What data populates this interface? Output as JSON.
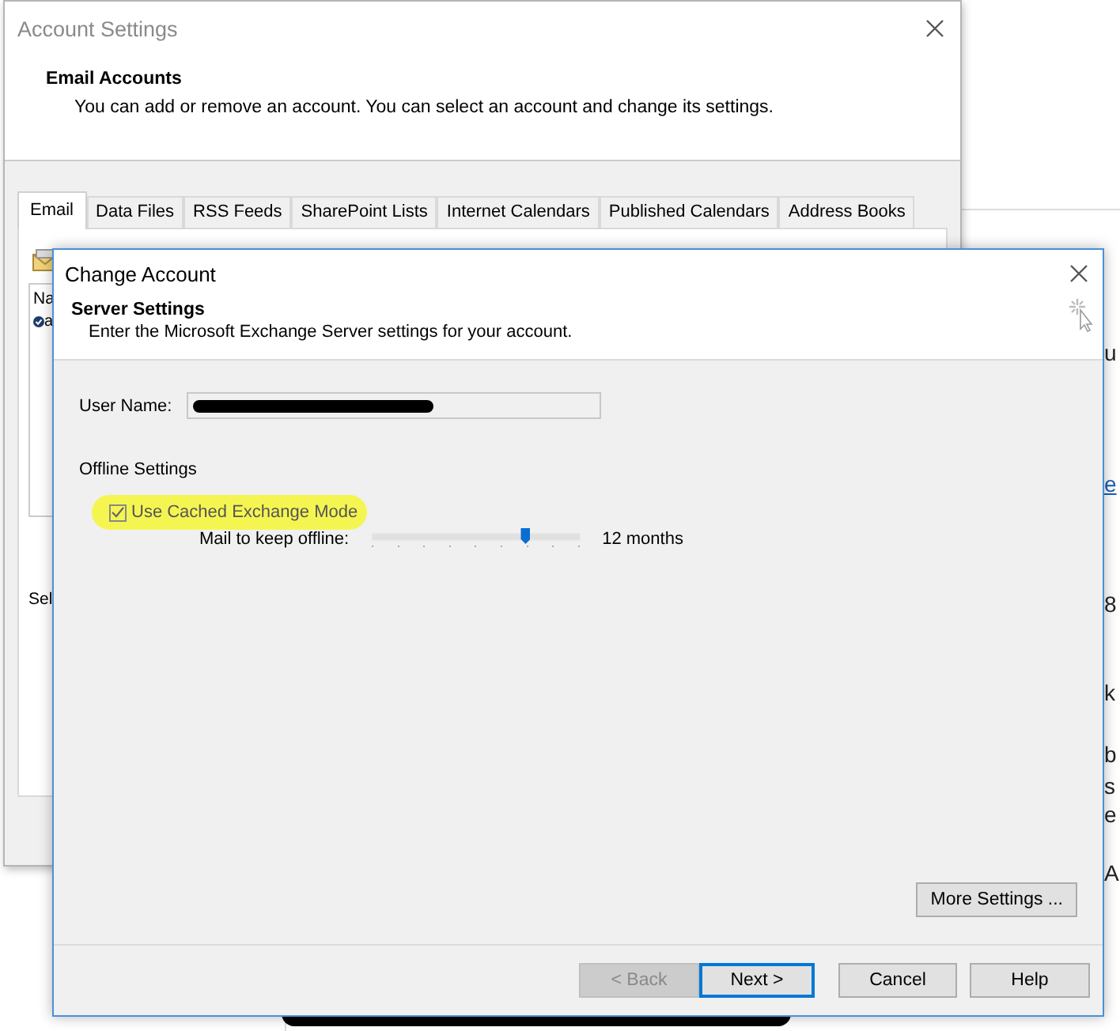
{
  "background_page": {
    "fragments": [
      "u",
      "e",
      "8",
      "k",
      "b",
      "s",
      "e",
      "A"
    ]
  },
  "account_settings": {
    "title": "Account Settings",
    "heading": "Email Accounts",
    "description": "You can add or remove an account. You can select an account and change its settings.",
    "tabs": [
      {
        "label": "Email",
        "selected": true
      },
      {
        "label": "Data Files",
        "selected": false
      },
      {
        "label": "RSS Feeds",
        "selected": false
      },
      {
        "label": "SharePoint Lists",
        "selected": false
      },
      {
        "label": "Internet Calendars",
        "selected": false
      },
      {
        "label": "Published Calendars",
        "selected": false
      },
      {
        "label": "Address Books",
        "selected": false
      }
    ],
    "list_header": "Na",
    "list_item": "a",
    "footer_text": "Sel"
  },
  "change_account": {
    "title": "Change Account",
    "heading": "Server Settings",
    "description": "Enter the Microsoft Exchange Server settings for your account.",
    "user_name_label": "User Name:",
    "offline_heading": "Offline Settings",
    "cached_mode": {
      "label": "Use Cached Exchange Mode",
      "checked": true,
      "highlighted": true
    },
    "slider": {
      "label": "Mail to keep offline:",
      "level": 0.74,
      "reading": "12 months"
    },
    "more_settings": "More Settings ...",
    "buttons": [
      {
        "label": "< Back",
        "disabled": true,
        "default": false
      },
      {
        "label": "Next >",
        "disabled": false,
        "default": true
      },
      {
        "label": "Cancel",
        "disabled": false,
        "default": false
      },
      {
        "label": "Help",
        "disabled": false,
        "default": false
      }
    ]
  }
}
